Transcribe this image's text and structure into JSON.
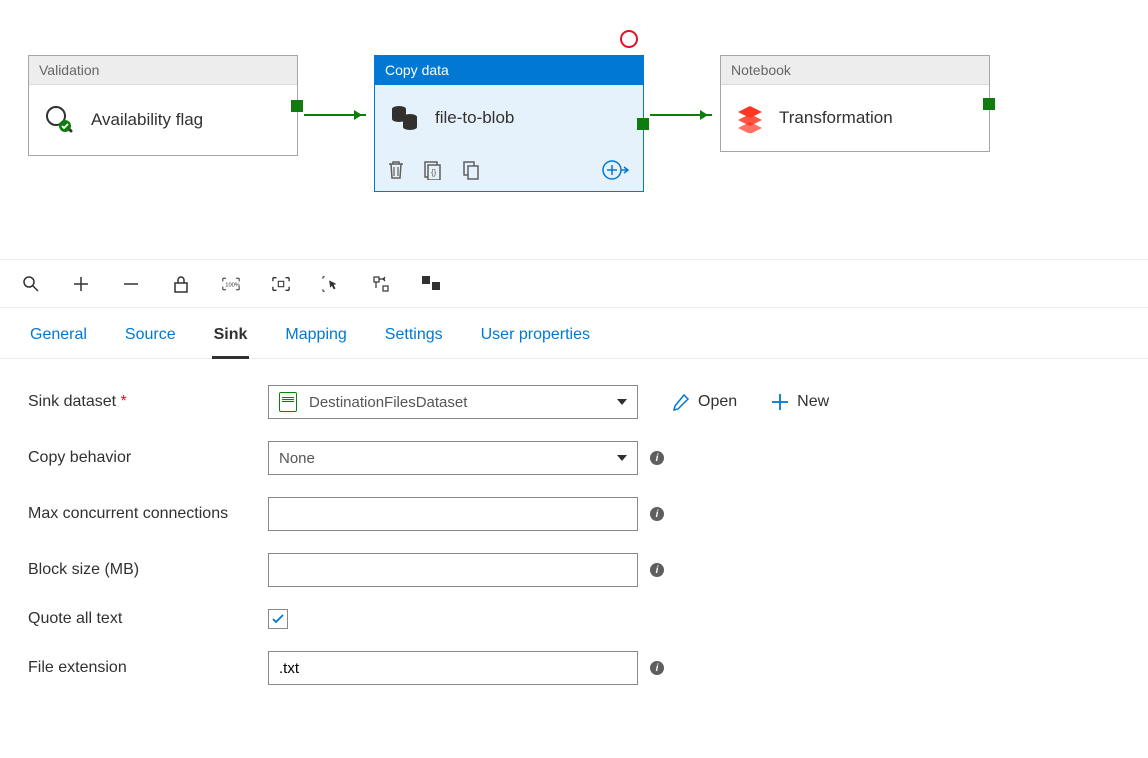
{
  "pipeline": {
    "activities": [
      {
        "type_label": "Validation",
        "name": "Availability flag"
      },
      {
        "type_label": "Copy data",
        "name": "file-to-blob"
      },
      {
        "type_label": "Notebook",
        "name": "Transformation"
      }
    ]
  },
  "tabs": {
    "general": "General",
    "source": "Source",
    "sink": "Sink",
    "mapping": "Mapping",
    "settings": "Settings",
    "user_properties": "User properties"
  },
  "sink": {
    "dataset_label": "Sink dataset",
    "dataset_value": "DestinationFilesDataset",
    "open_label": "Open",
    "new_label": "New",
    "copy_behavior_label": "Copy behavior",
    "copy_behavior_value": "None",
    "max_conn_label": "Max concurrent connections",
    "max_conn_value": "",
    "block_size_label": "Block size (MB)",
    "block_size_value": "",
    "quote_all_label": "Quote all text",
    "quote_all_checked": true,
    "file_ext_label": "File extension",
    "file_ext_value": ".txt"
  }
}
